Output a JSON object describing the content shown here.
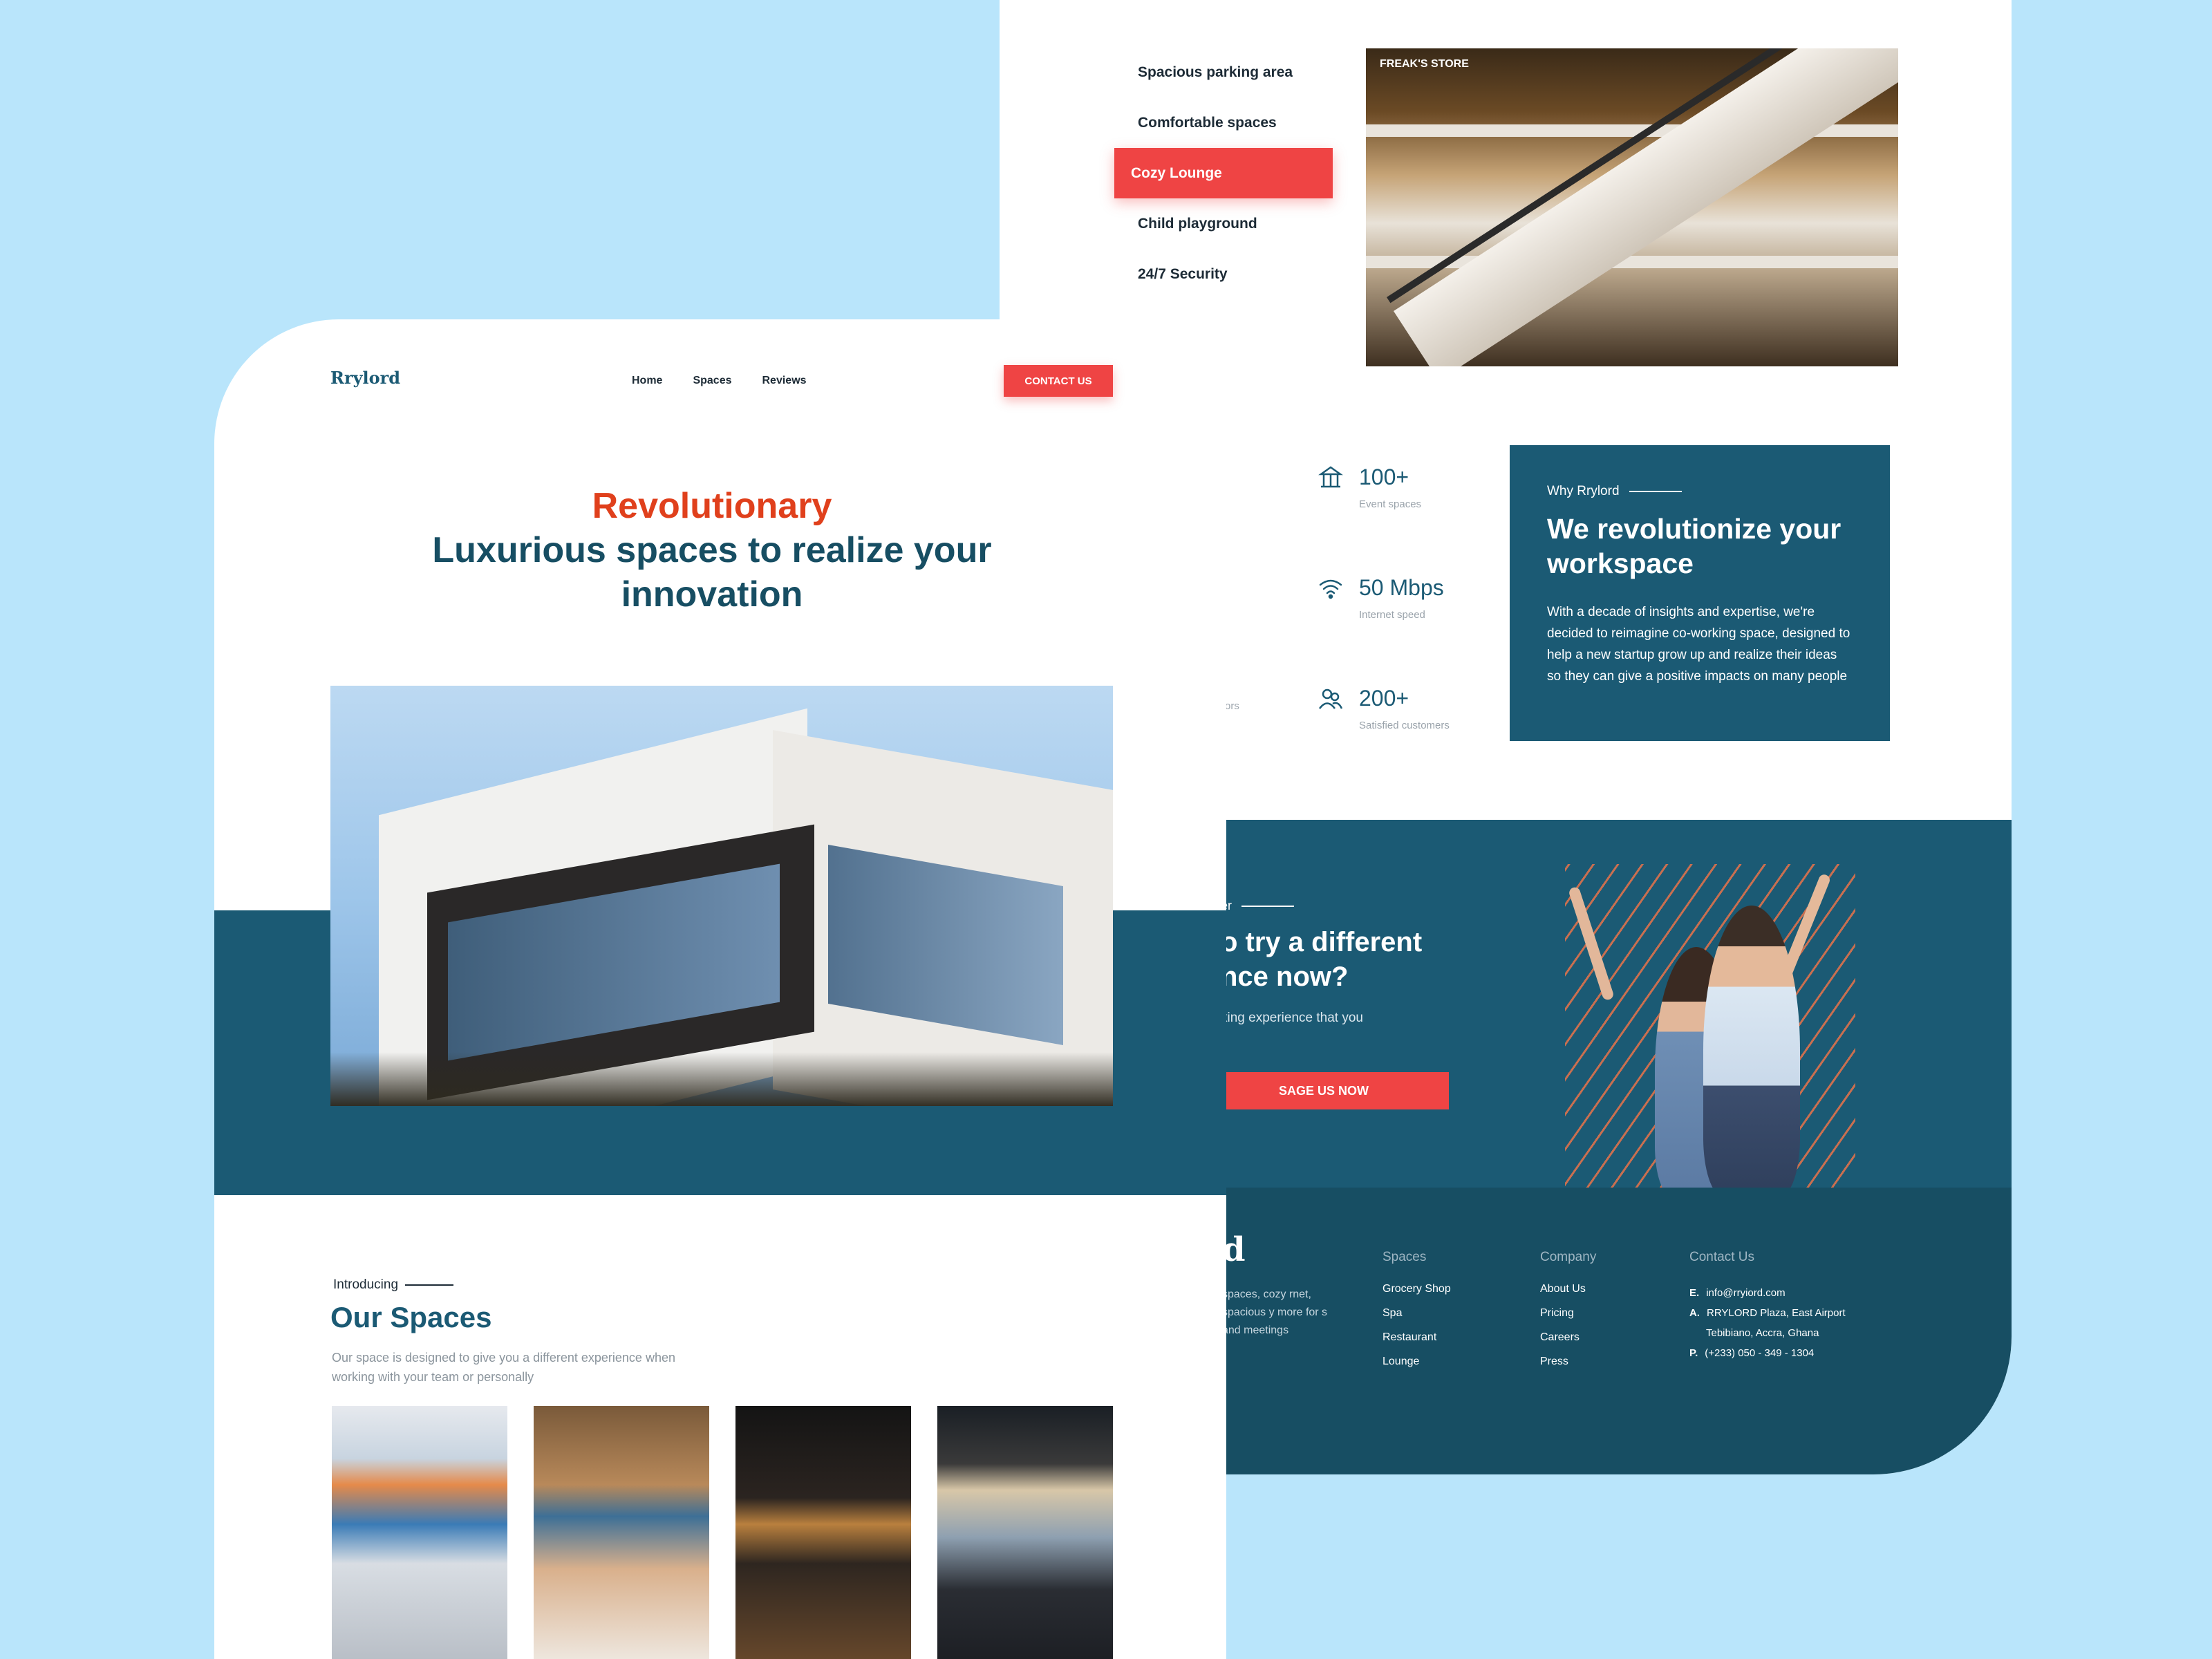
{
  "back": {
    "amenities": [
      {
        "label": "Spacious parking area",
        "active": false
      },
      {
        "label": "Comfortable spaces",
        "active": false
      },
      {
        "label": "Cozy Lounge",
        "active": true
      },
      {
        "label": "Child playground",
        "active": false
      },
      {
        "label": "24/7 Security",
        "active": false
      }
    ],
    "photo_sign": "FREAK'S STORE",
    "stats": [
      {
        "icon": "carousel-icon",
        "value": "100+",
        "label": "Event spaces"
      },
      {
        "icon": "wifi-icon",
        "value": "50 Mbps",
        "label": "Internet speed"
      },
      {
        "icon": "users-icon",
        "value": "200+",
        "label": "Satisfied customers"
      }
    ],
    "cut_ors": "ors",
    "why": {
      "eyebrow": "Why Rrylord",
      "title": "We revolutionize your workspace",
      "body": "With a decade of insights and expertise, we're decided to reimagine co-working space, designed to help a new startup grow up and realize their ideas so they can give a positive impacts on many people"
    },
    "cta": {
      "eyebrow": "er",
      "title": "o try a different nce now?",
      "sub": "king experience that you",
      "button": "SAGE US NOW"
    },
    "footer": {
      "logo": "d",
      "about": "spaces, cozy rnet, spacious y more for s and meetings",
      "spaces_title": "Spaces",
      "spaces_links": [
        "Grocery Shop",
        "Spa",
        "Restaurant",
        "Lounge"
      ],
      "company_title": "Company",
      "company_links": [
        "About Us",
        "Pricing",
        "Careers",
        "Press"
      ],
      "contact_title": "Contact Us",
      "email_prefix": "E.",
      "email": "info@rryiord.com",
      "address_prefix": "A.",
      "address_1": "RRYLORD Plaza, East Airport",
      "address_2": "Tebibiano, Accra, Ghana",
      "phone_prefix": "P.",
      "phone": "(+233) 050 - 349 - 1304"
    }
  },
  "front": {
    "logo": "Rrylord",
    "nav": [
      "Home",
      "Spaces",
      "Reviews"
    ],
    "contact_button": "CONTACT US",
    "hero_accent": "Revolutionary",
    "hero_line": "Luxurious spaces to realize your innovation",
    "spaces_eyebrow": "Introducing",
    "spaces_title": "Our Spaces",
    "spaces_desc": "Our space is designed to give you a different experience when working with your team or personally"
  },
  "colors": {
    "primary": "#1b5a74",
    "accent": "#ef4444",
    "background": "#b9e5fb"
  }
}
